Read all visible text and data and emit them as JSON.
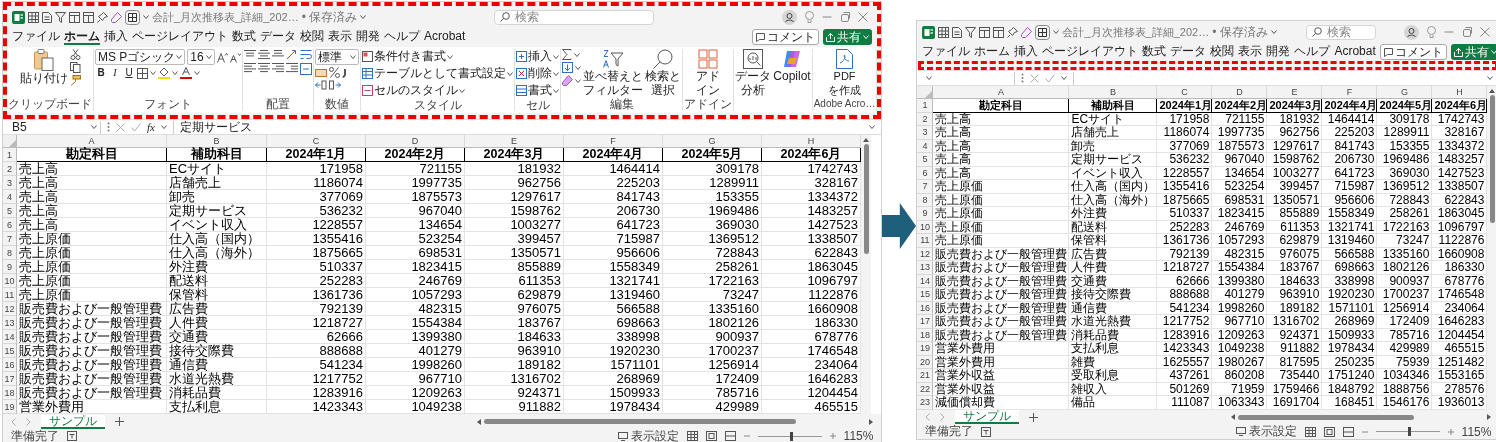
{
  "left_window": {
    "highlighted": true,
    "title_bar": {
      "title": "会計_月次推移表_詳細_202…",
      "save_status": "• 保存済み",
      "search_placeholder": "検索"
    },
    "menu_tabs": [
      {
        "label": "ファイル",
        "selected": false
      },
      {
        "label": "ホーム",
        "selected": true
      },
      {
        "label": "挿入",
        "selected": false
      },
      {
        "label": "ページレイアウト",
        "selected": false
      },
      {
        "label": "数式",
        "selected": false
      },
      {
        "label": "データ",
        "selected": false
      },
      {
        "label": "校閲",
        "selected": false
      },
      {
        "label": "表示",
        "selected": false
      },
      {
        "label": "開発",
        "selected": false
      },
      {
        "label": "ヘルプ",
        "selected": false
      },
      {
        "label": "Acrobat",
        "selected": false
      }
    ],
    "comment_button": "コメント",
    "share_button": "共有",
    "ribbon": {
      "groups": [
        {
          "kind": "clipboard",
          "label": "クリップボード",
          "items": [
            {
              "lines": [
                "貼り付け"
              ]
            }
          ]
        },
        {
          "kind": "font",
          "label": "フォント",
          "font_name": "MS Pゴシック",
          "font_size": "16",
          "style_buttons": [
            "B",
            "I",
            "U"
          ]
        },
        {
          "kind": "alignment",
          "label": "配置"
        },
        {
          "kind": "number",
          "label": "数値",
          "format": "標準"
        },
        {
          "kind": "styles",
          "label": "スタイル",
          "items": [
            "条件付き書式",
            "テーブルとして書式設定",
            "セルのスタイル"
          ]
        },
        {
          "kind": "cells",
          "label": "セル",
          "items": [
            "挿入",
            "削除",
            "書式"
          ]
        },
        {
          "kind": "editing",
          "label": "編集",
          "items": [
            {
              "lines": [
                "並べ替えと",
                "フィルター"
              ]
            },
            {
              "lines": [
                "検索と",
                "選択"
              ]
            }
          ]
        },
        {
          "kind": "addins",
          "label": "アドイン",
          "items": [
            {
              "lines": [
                "アド",
                "イン"
              ]
            }
          ]
        },
        {
          "kind": "tools",
          "items": [
            {
              "lines": [
                "データ",
                "分析"
              ]
            },
            {
              "lines": [
                "Copilot"
              ]
            }
          ]
        },
        {
          "kind": "adobe",
          "label": "Adobe Acro…",
          "items": [
            {
              "lines": [
                "PDF",
                "を作成"
              ]
            }
          ]
        }
      ]
    },
    "formula_bar": {
      "name_box": "B5",
      "fx_label": "fx",
      "formula": "定期サービス"
    },
    "columns": [
      "A",
      "B",
      "C",
      "D",
      "E",
      "F",
      "G",
      "H"
    ],
    "rows": [
      {
        "number": "1",
        "kind": "header",
        "cells": [
          "勘定科目",
          "補助科目",
          "2024年1月",
          "2024年2月",
          "2024年3月",
          "2024年4月",
          "2024年5月",
          "2024年6月"
        ]
      },
      {
        "number": "2",
        "kind": "data",
        "cells": [
          "売上高",
          "ECサイト",
          "171958",
          "721155",
          "181932",
          "1464414",
          "309178",
          "1742743"
        ]
      },
      {
        "number": "3",
        "kind": "data",
        "cells": [
          "売上高",
          "店舗売上",
          "1186074",
          "1997735",
          "962756",
          "225203",
          "1289911",
          "328167"
        ]
      },
      {
        "number": "4",
        "kind": "data",
        "cells": [
          "売上高",
          "卸売",
          "377069",
          "1875573",
          "1297617",
          "841743",
          "153355",
          "1334372"
        ]
      },
      {
        "number": "5",
        "kind": "data",
        "cells": [
          "売上高",
          "定期サービス",
          "536232",
          "967040",
          "1598762",
          "206730",
          "1969486",
          "1483257"
        ]
      },
      {
        "number": "6",
        "kind": "data",
        "cells": [
          "売上高",
          "イベント収入",
          "1228557",
          "134654",
          "1003277",
          "641723",
          "369030",
          "1427523"
        ]
      },
      {
        "number": "7",
        "kind": "data",
        "cells": [
          "売上原価",
          "仕入高（国内）",
          "1355416",
          "523254",
          "399457",
          "715987",
          "1369512",
          "1338507"
        ]
      },
      {
        "number": "8",
        "kind": "data",
        "cells": [
          "売上原価",
          "仕入高（海外）",
          "1875665",
          "698531",
          "1350571",
          "956606",
          "728843",
          "622843"
        ]
      },
      {
        "number": "9",
        "kind": "data",
        "cells": [
          "売上原価",
          "外注費",
          "510337",
          "1823415",
          "855889",
          "1558349",
          "258261",
          "1863045"
        ]
      },
      {
        "number": "10",
        "kind": "data",
        "cells": [
          "売上原価",
          "配送料",
          "252283",
          "246769",
          "611353",
          "1321741",
          "1722163",
          "1096797"
        ]
      },
      {
        "number": "11",
        "kind": "data",
        "cells": [
          "売上原価",
          "保管料",
          "1361736",
          "1057293",
          "629879",
          "1319460",
          "73247",
          "1122876"
        ]
      },
      {
        "number": "12",
        "kind": "data",
        "cells": [
          "販売費および一般管理費",
          "広告費",
          "792139",
          "482315",
          "976075",
          "566588",
          "1335160",
          "1660908"
        ]
      },
      {
        "number": "13",
        "kind": "data",
        "cells": [
          "販売費および一般管理費",
          "人件費",
          "1218727",
          "1554384",
          "183767",
          "698663",
          "1802126",
          "186330"
        ]
      },
      {
        "number": "14",
        "kind": "data",
        "cells": [
          "販売費および一般管理費",
          "交通費",
          "62666",
          "1399380",
          "184633",
          "338998",
          "900937",
          "678776"
        ]
      },
      {
        "number": "15",
        "kind": "data",
        "cells": [
          "販売費および一般管理費",
          "接待交際費",
          "888688",
          "401279",
          "963910",
          "1920230",
          "1700237",
          "1746548"
        ]
      },
      {
        "number": "16",
        "kind": "data",
        "cells": [
          "販売費および一般管理費",
          "通信費",
          "541234",
          "1998260",
          "189182",
          "1571101",
          "1256914",
          "234064"
        ]
      },
      {
        "number": "17",
        "kind": "data",
        "cells": [
          "販売費および一般管理費",
          "水道光熱費",
          "1217752",
          "967710",
          "1316702",
          "268969",
          "172409",
          "1646283"
        ]
      },
      {
        "number": "18",
        "kind": "data",
        "cells": [
          "販売費および一般管理費",
          "消耗品費",
          "1283916",
          "1209263",
          "924371",
          "1509933",
          "785716",
          "1204454"
        ]
      },
      {
        "number": "19",
        "kind": "data",
        "cells": [
          "営業外費用",
          "支払利息",
          "1423343",
          "1049238",
          "911882",
          "1978434",
          "429989",
          "465515"
        ]
      }
    ],
    "sheet_tabs": [
      {
        "label": "サンプル",
        "selected": true
      }
    ],
    "status_bar": {
      "status": "準備完了",
      "view_settings": "表示設定",
      "zoom_slider": {
        "level": 0.53
      },
      "zoom": "115%"
    }
  },
  "right_window": {
    "highlighted": true,
    "title_bar": {
      "title": "会計_月次推移表_詳細_202…",
      "save_status": "• 保存済み",
      "search_placeholder": "検索"
    },
    "menu_tabs": [
      {
        "label": "ファイル",
        "selected": false
      },
      {
        "label": "ホーム",
        "selected": false
      },
      {
        "label": "挿入",
        "selected": false
      },
      {
        "label": "ページレイアウト",
        "selected": false
      },
      {
        "label": "数式",
        "selected": false
      },
      {
        "label": "データ",
        "selected": false
      },
      {
        "label": "校閲",
        "selected": false
      },
      {
        "label": "表示",
        "selected": false
      },
      {
        "label": "開発",
        "selected": false
      },
      {
        "label": "ヘルプ",
        "selected": false
      },
      {
        "label": "Acrobat",
        "selected": false
      }
    ],
    "comment_button": "コメント",
    "share_button": "共有",
    "columns": [
      "A",
      "B",
      "C",
      "D",
      "E",
      "F",
      "G",
      "H"
    ],
    "rows": [
      {
        "number": "1",
        "kind": "header",
        "cells": [
          "勘定科目",
          "補助科目",
          "2024年1月",
          "2024年2月",
          "2024年3月",
          "2024年4月",
          "2024年5月",
          "2024年6月"
        ]
      },
      {
        "number": "2",
        "kind": "data",
        "cells": [
          "売上高",
          "ECサイト",
          "171958",
          "721155",
          "181932",
          "1464414",
          "309178",
          "1742743"
        ]
      },
      {
        "number": "3",
        "kind": "data",
        "cells": [
          "売上高",
          "店舗売上",
          "1186074",
          "1997735",
          "962756",
          "225203",
          "1289911",
          "328167"
        ]
      },
      {
        "number": "4",
        "kind": "data",
        "cells": [
          "売上高",
          "卸売",
          "377069",
          "1875573",
          "1297617",
          "841743",
          "153355",
          "1334372"
        ]
      },
      {
        "number": "5",
        "kind": "data",
        "cells": [
          "売上高",
          "定期サービス",
          "536232",
          "967040",
          "1598762",
          "206730",
          "1969486",
          "1483257"
        ]
      },
      {
        "number": "6",
        "kind": "data",
        "cells": [
          "売上高",
          "イベント収入",
          "1228557",
          "134654",
          "1003277",
          "641723",
          "369030",
          "1427523"
        ]
      },
      {
        "number": "7",
        "kind": "data",
        "cells": [
          "売上原価",
          "仕入高（国内）",
          "1355416",
          "523254",
          "399457",
          "715987",
          "1369512",
          "1338507"
        ]
      },
      {
        "number": "8",
        "kind": "data",
        "cells": [
          "売上原価",
          "仕入高（海外）",
          "1875665",
          "698531",
          "1350571",
          "956606",
          "728843",
          "622843"
        ]
      },
      {
        "number": "9",
        "kind": "data",
        "cells": [
          "売上原価",
          "外注費",
          "510337",
          "1823415",
          "855889",
          "1558349",
          "258261",
          "1863045"
        ]
      },
      {
        "number": "10",
        "kind": "data",
        "cells": [
          "売上原価",
          "配送料",
          "252283",
          "246769",
          "611353",
          "1321741",
          "1722163",
          "1096797"
        ]
      },
      {
        "number": "11",
        "kind": "data",
        "cells": [
          "売上原価",
          "保管料",
          "1361736",
          "1057293",
          "629879",
          "1319460",
          "73247",
          "1122876"
        ]
      },
      {
        "number": "12",
        "kind": "data",
        "cells": [
          "販売費および一般管理費",
          "広告費",
          "792139",
          "482315",
          "976075",
          "566588",
          "1335160",
          "1660908"
        ]
      },
      {
        "number": "13",
        "kind": "data",
        "cells": [
          "販売費および一般管理費",
          "人件費",
          "1218727",
          "1554384",
          "183767",
          "698663",
          "1802126",
          "186330"
        ]
      },
      {
        "number": "14",
        "kind": "data",
        "cells": [
          "販売費および一般管理費",
          "交通費",
          "62666",
          "1399380",
          "184633",
          "338998",
          "900937",
          "678776"
        ]
      },
      {
        "number": "15",
        "kind": "data",
        "cells": [
          "販売費および一般管理費",
          "接待交際費",
          "888688",
          "401279",
          "963910",
          "1920230",
          "1700237",
          "1746548"
        ]
      },
      {
        "number": "16",
        "kind": "data",
        "cells": [
          "販売費および一般管理費",
          "通信費",
          "541234",
          "1998260",
          "189182",
          "1571101",
          "1256914",
          "234064"
        ]
      },
      {
        "number": "17",
        "kind": "data",
        "cells": [
          "販売費および一般管理費",
          "水道光熱費",
          "1217752",
          "967710",
          "1316702",
          "268969",
          "172409",
          "1646283"
        ]
      },
      {
        "number": "18",
        "kind": "data",
        "cells": [
          "販売費および一般管理費",
          "消耗品費",
          "1283916",
          "1209263",
          "924371",
          "1509933",
          "785716",
          "1204454"
        ]
      },
      {
        "number": "19",
        "kind": "data",
        "cells": [
          "営業外費用",
          "支払利息",
          "1423343",
          "1049238",
          "911882",
          "1978434",
          "429989",
          "465515"
        ]
      },
      {
        "number": "20",
        "kind": "data",
        "cells": [
          "営業外費用",
          "雑費",
          "1625557",
          "1980267",
          "817595",
          "250235",
          "75939",
          "1251482"
        ]
      },
      {
        "number": "21",
        "kind": "data",
        "cells": [
          "営業外収益",
          "受取利息",
          "437261",
          "860208",
          "735440",
          "1751240",
          "1034346",
          "1553165"
        ]
      },
      {
        "number": "22",
        "kind": "data",
        "cells": [
          "営業外収益",
          "雑収入",
          "501269",
          "71959",
          "1759466",
          "1848792",
          "1888756",
          "278576"
        ]
      },
      {
        "number": "23",
        "kind": "data",
        "cells": [
          "減価償却費",
          "備品",
          "111087",
          "1063343",
          "1691704",
          "168451",
          "1546176",
          "1936013"
        ]
      }
    ],
    "sheet_tabs": [
      {
        "label": "サンプル",
        "selected": true
      }
    ],
    "status_bar": {
      "status": "準備完了",
      "view_settings": "表示設定",
      "zoom_slider": {
        "level": 0.53
      },
      "zoom": "115%"
    }
  }
}
